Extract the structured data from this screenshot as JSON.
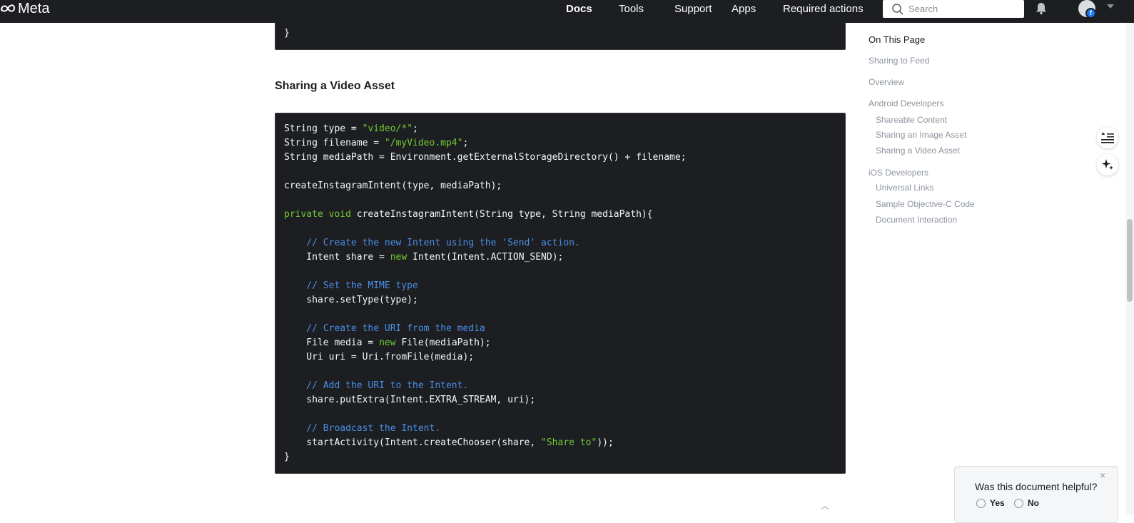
{
  "header": {
    "logo_text": "Meta",
    "nav": [
      "Docs",
      "Tools",
      "Support",
      "Apps",
      "Required actions"
    ],
    "search_placeholder": "Search"
  },
  "top_code": {
    "closing_brace": "}"
  },
  "section_title": "Sharing a Video Asset",
  "code_main": {
    "l1a": "String type = ",
    "l1b": "\"video/*\"",
    "l1c": ";",
    "l2a": "String filename = ",
    "l2b": "\"/myVideo.mp4\"",
    "l2c": ";",
    "l3": "String mediaPath = Environment.getExternalStorageDirectory() + filename;",
    "l5": "createInstagramIntent(type, mediaPath);",
    "l7a": "private void",
    "l7b": " createInstagramIntent(String type, String mediaPath){",
    "l9": "    // Create the new Intent using the 'Send' action.",
    "l10a": "    Intent share = ",
    "l10b": "new",
    "l10c": " Intent(Intent.ACTION_SEND);",
    "l12": "    // Set the MIME type",
    "l13": "    share.setType(type);",
    "l15": "    // Create the URI from the media",
    "l16a": "    File media = ",
    "l16b": "new",
    "l16c": " File(mediaPath);",
    "l17": "    Uri uri = Uri.fromFile(media);",
    "l19": "    // Add the URI to the Intent.",
    "l20": "    share.putExtra(Intent.EXTRA_STREAM, uri);",
    "l22": "    // Broadcast the Intent.",
    "l23a": "    startActivity(Intent.createChooser(share, ",
    "l23b": "\"Share to\"",
    "l23c": "));",
    "l24": "}"
  },
  "toc": {
    "heading": "On This Page",
    "items": [
      "Sharing to Feed",
      "Overview",
      "Android Developers",
      "Shareable Content",
      "Sharing an Image Asset",
      "Sharing a Video Asset",
      "iOS Developers",
      "Universal Links",
      "Sample Objective-C Code",
      "Document Interaction"
    ]
  },
  "feedback": {
    "question": "Was this document helpful?",
    "yes": "Yes",
    "no": "No",
    "close": "×"
  },
  "colors": {
    "topbar": "#1c1e21",
    "code_bg": "#1c1e21",
    "string": "#73c935",
    "comment": "#4a8fe7"
  }
}
